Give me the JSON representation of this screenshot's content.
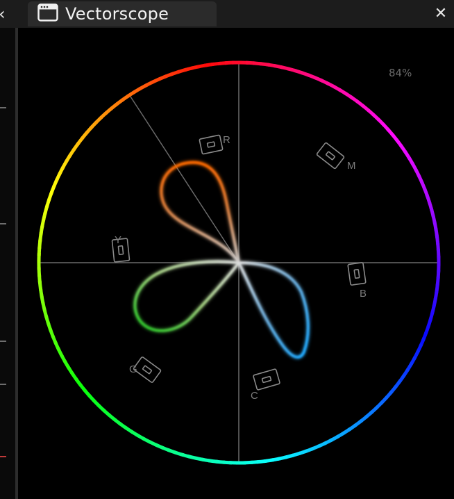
{
  "sidebar": {
    "collapse_glyph": "‹"
  },
  "tab": {
    "title": "Vectorscope",
    "icon": "window-icon"
  },
  "close_glyph": "✕",
  "scope": {
    "zoom_percent": "84%",
    "targets": [
      {
        "id": "R",
        "label": "R"
      },
      {
        "id": "M",
        "label": "M"
      },
      {
        "id": "B",
        "label": "B"
      },
      {
        "id": "C",
        "label": "C"
      },
      {
        "id": "G",
        "label": "G"
      },
      {
        "id": "Y",
        "label": "Y"
      }
    ],
    "colors": {
      "background": "#000000",
      "graticule": "#6a6a6a",
      "target_box": "#8a8a8a"
    }
  }
}
